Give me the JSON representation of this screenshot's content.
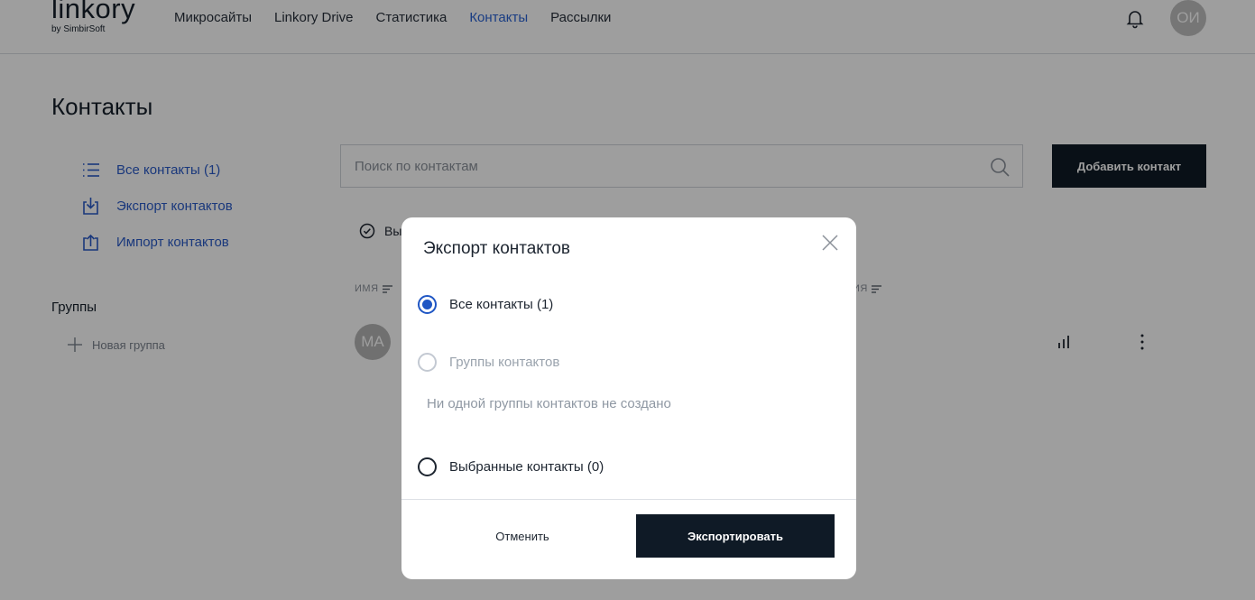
{
  "header": {
    "logo": "linkory",
    "logo_sub": "by SimbirSoft",
    "nav": [
      "Микросайты",
      "Linkory Drive",
      "Статистика",
      "Контакты",
      "Рассылки"
    ],
    "active_nav": "Контакты",
    "avatar_initials": "ОИ"
  },
  "page": {
    "title": "Контакты",
    "sidebar": {
      "all_contacts": "Все контакты (1)",
      "export": "Экспорт контактов",
      "import": "Импорт контактов",
      "groups_title": "Группы",
      "new_group": "Новая группа"
    },
    "search": {
      "placeholder": "Поиск по контактам"
    },
    "add_button": "Добавить контакт",
    "select_label": "Вы",
    "columns": {
      "name": "ИМЯ",
      "other": "ИЯ"
    },
    "row": {
      "avatar_initials": "МА"
    }
  },
  "modal": {
    "title": "Экспорт контактов",
    "options": {
      "all": "Все контакты (1)",
      "groups": "Группы контактов",
      "selected": "Выбранные контакты (0)"
    },
    "selected_option": "all",
    "no_groups_hint": "Ни одной группы контактов не создано",
    "cancel": "Отменить",
    "export": "Экспортировать"
  },
  "colors": {
    "accent": "#2a63d4",
    "dark_button": "#0f1a26",
    "overlay": "rgba(0,0,0,0.38)"
  }
}
